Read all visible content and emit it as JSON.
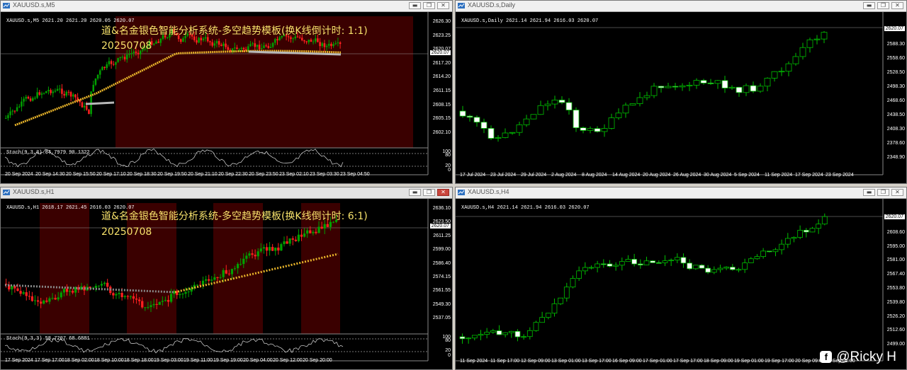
{
  "windows": {
    "m5": {
      "title": "XAUUSD.s,M5",
      "symbol_line": "XAUUSD.s,M5  2621.20 2621.20 2620.05 2620.07",
      "cn_title": "道&名金银色智能分析系统-多空趋势模板(换K线倒计时: 1:1)",
      "cn_date": "20250708",
      "stoch_label": "Stoch(9,3,3) 84.7979 90.1322",
      "price": "2620.07",
      "y_ticks": [
        "2626.30",
        "2623.25",
        "2620.07",
        "2617.20",
        "2614.20",
        "2611.15",
        "2608.15",
        "2605.15",
        "2602.10"
      ],
      "sub_ticks": [
        "100",
        "80",
        "20",
        "0"
      ],
      "x_ticks": [
        "20 Sep 2024",
        "20 Sep 14:30",
        "20 Sep 15:50",
        "20 Sep 17:10",
        "20 Sep 18:30",
        "20 Sep 19:50",
        "20 Sep 21:10",
        "20 Sep 22:30",
        "20 Sep 23:50",
        "23 Sep 02:10",
        "23 Sep 03:30",
        "23 Sep 04:50"
      ]
    },
    "daily": {
      "title": "XAUUSD.s,Daily",
      "symbol_line": "XAUUSD.s,Daily  2621.14 2621.94 2616.03 2620.07",
      "price": "2620.07",
      "y_ticks": [
        "2620.07",
        "2588.30",
        "2558.60",
        "2528.50",
        "2498.30",
        "2468.60",
        "2438.50",
        "2408.30",
        "2378.60",
        "2348.90"
      ],
      "x_ticks": [
        "17 Jul 2024",
        "23 Jul 2024",
        "29 Jul 2024",
        "2 Aug 2024",
        "8 Aug 2024",
        "14 Aug 2024",
        "20 Aug 2024",
        "26 Aug 2024",
        "30 Aug 2024",
        "5 Sep 2024",
        "11 Sep 2024",
        "17 Sep 2024",
        "23 Sep 2024"
      ]
    },
    "h1": {
      "title": "XAUUSD.s,H1",
      "symbol_line": "XAUUSD.s,H1  2618.17 2621.45 2616.03 2620.07",
      "cn_title": "道&名金银色智能分析系统-多空趋势模板(换K线倒计时: 6:1)",
      "cn_date": "20250708",
      "stoch_label": "Stoch(9,3,3) 58.7207 68.6881",
      "price": "2620.07",
      "y_ticks": [
        "2636.10",
        "2623.50",
        "2611.25",
        "2599.00",
        "2586.40",
        "2574.15",
        "2561.55",
        "2549.30",
        "2537.05"
      ],
      "sub_ticks": [
        "100",
        "80",
        "20",
        "0"
      ],
      "x_ticks": [
        "17 Sep 2024",
        "17 Sep 17:00",
        "18 Sep 02:00",
        "18 Sep 10:00",
        "18 Sep 18:00",
        "19 Sep 03:00",
        "19 Sep 11:00",
        "19 Sep 19:00",
        "20 Sep 04:00",
        "20 Sep 12:00",
        "20 Sep 20:00"
      ]
    },
    "h4": {
      "title": "XAUUSD.s,H4",
      "symbol_line": "XAUUSD.s,H4  2621.14 2621.94 2616.03 2620.07",
      "price": "2620.07",
      "y_ticks": [
        "2620.07",
        "2608.60",
        "2595.00",
        "2581.00",
        "2567.40",
        "2553.80",
        "2539.80",
        "2526.20",
        "2512.60",
        "2499.00"
      ],
      "x_ticks": [
        "11 Sep 2024",
        "11 Sep 17:00",
        "12 Sep 09:00",
        "13 Sep 01:00",
        "13 Sep 17:00",
        "16 Sep 09:00",
        "17 Sep 01:00",
        "17 Sep 17:00",
        "18 Sep 09:00",
        "19 Sep 01:00",
        "19 Sep 17:00",
        "20 Sep 09:00",
        "23 Sep 01:00"
      ]
    }
  },
  "watermark": {
    "text": "@Ricky H",
    "logo": "f"
  },
  "colors": {
    "bull": "#00a000",
    "bear": "#ff2020",
    "daily_bull": "#00c000",
    "bg_red": "#3a0000",
    "ma_gold": "#e8b42a",
    "ma_gray": "#b8b8b8"
  },
  "window_buttons": {
    "min": "▬",
    "max": "❐",
    "close": "✕"
  }
}
